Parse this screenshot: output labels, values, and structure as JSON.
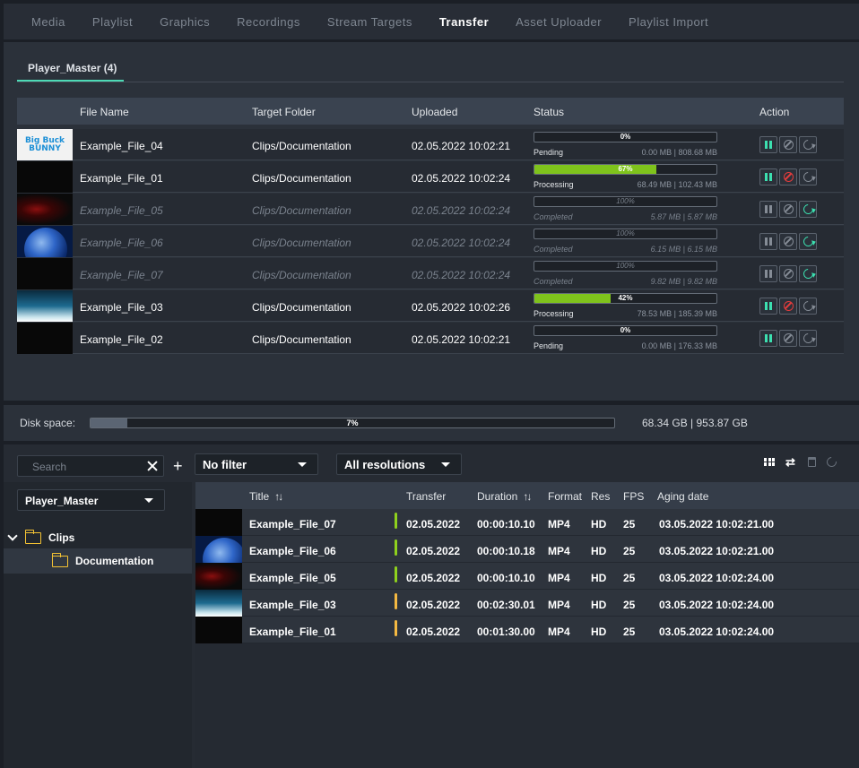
{
  "nav": {
    "tabs": [
      {
        "label": "Media"
      },
      {
        "label": "Playlist"
      },
      {
        "label": "Graphics"
      },
      {
        "label": "Recordings"
      },
      {
        "label": "Stream Targets"
      },
      {
        "label": "Transfer",
        "active": true
      },
      {
        "label": "Asset Uploader"
      },
      {
        "label": "Playlist Import"
      }
    ]
  },
  "transfer": {
    "subtab": "Player_Master (4)",
    "headers": {
      "file_name": "File Name",
      "target_folder": "Target Folder",
      "uploaded": "Uploaded",
      "status": "Status",
      "action": "Action"
    },
    "rows": [
      {
        "file_name": "Example_File_04",
        "target_folder": "Clips/Documentation",
        "uploaded": "02.05.2022 10:02:21",
        "progress": 0,
        "pct": "0%",
        "status": "Pending",
        "size": "0.00 MB | 808.68 MB",
        "thumb": "bunny",
        "pause": "on",
        "cancel": "grey",
        "retry": "grey",
        "done": false
      },
      {
        "file_name": "Example_File_01",
        "target_folder": "Clips/Documentation",
        "uploaded": "02.05.2022 10:02:24",
        "progress": 67,
        "pct": "67%",
        "status": "Processing",
        "size": "68.49 MB | 102.43 MB",
        "thumb": "black",
        "pause": "on",
        "cancel": "red",
        "retry": "grey",
        "done": false
      },
      {
        "file_name": "Example_File_05",
        "target_folder": "Clips/Documentation",
        "uploaded": "02.05.2022 10:02:24",
        "progress": 0,
        "pct": "100%",
        "status": "Completed",
        "size": "5.87 MB | 5.87 MB",
        "thumb": "red",
        "pause": "off",
        "cancel": "grey",
        "retry": "on",
        "done": true
      },
      {
        "file_name": "Example_File_06",
        "target_folder": "Clips/Documentation",
        "uploaded": "02.05.2022 10:02:24",
        "progress": 0,
        "pct": "100%",
        "status": "Completed",
        "size": "6.15 MB | 6.15 MB",
        "thumb": "earth",
        "pause": "off",
        "cancel": "grey",
        "retry": "on",
        "done": true
      },
      {
        "file_name": "Example_File_07",
        "target_folder": "Clips/Documentation",
        "uploaded": "02.05.2022 10:02:24",
        "progress": 0,
        "pct": "100%",
        "status": "Completed",
        "size": "9.82 MB | 9.82 MB",
        "thumb": "black",
        "pause": "off",
        "cancel": "grey",
        "retry": "on",
        "done": true
      },
      {
        "file_name": "Example_File_03",
        "target_folder": "Clips/Documentation",
        "uploaded": "02.05.2022 10:02:26",
        "progress": 42,
        "pct": "42%",
        "status": "Processing",
        "size": "78.53 MB | 185.39 MB",
        "thumb": "sky",
        "pause": "on",
        "cancel": "red",
        "retry": "grey",
        "done": false
      },
      {
        "file_name": "Example_File_02",
        "target_folder": "Clips/Documentation",
        "uploaded": "02.05.2022 10:02:21",
        "progress": 0,
        "pct": "0%",
        "status": "Pending",
        "size": "0.00 MB | 176.33 MB",
        "thumb": "black",
        "pause": "on",
        "cancel": "grey",
        "retry": "grey",
        "done": false
      }
    ]
  },
  "disk": {
    "label": "Disk space:",
    "progress": 7,
    "pct": "7%",
    "size": "68.34 GB | 953.87 GB"
  },
  "asset": {
    "search_placeholder": "Search",
    "filter": "No filter",
    "resolution": "All resolutions",
    "player": "Player_Master",
    "tree": {
      "root": "Clips",
      "child": "Documentation"
    },
    "headers": {
      "title": "Title",
      "transfer": "Transfer",
      "duration": "Duration",
      "format": "Format",
      "res": "Res",
      "fps": "FPS",
      "aging": "Aging date"
    },
    "rows": [
      {
        "title": "Example_File_07",
        "transfer": "02.05.2022",
        "duration": "00:00:10.10",
        "format": "MP4",
        "res": "HD",
        "fps": "25",
        "aging": "03.05.2022 10:02:21.00",
        "flag": "#8fd11d",
        "thumb": "black"
      },
      {
        "title": "Example_File_06",
        "transfer": "02.05.2022",
        "duration": "00:00:10.18",
        "format": "MP4",
        "res": "HD",
        "fps": "25",
        "aging": "03.05.2022 10:02:21.00",
        "flag": "#8fd11d",
        "thumb": "earth"
      },
      {
        "title": "Example_File_05",
        "transfer": "02.05.2022",
        "duration": "00:00:10.10",
        "format": "MP4",
        "res": "HD",
        "fps": "25",
        "aging": "03.05.2022 10:02:24.00",
        "flag": "#8fd11d",
        "thumb": "red"
      },
      {
        "title": "Example_File_03",
        "transfer": "02.05.2022",
        "duration": "00:02:30.01",
        "format": "MP4",
        "res": "HD",
        "fps": "25",
        "aging": "03.05.2022 10:02:24.00",
        "flag": "#f5b942",
        "thumb": "sky"
      },
      {
        "title": "Example_File_01",
        "transfer": "02.05.2022",
        "duration": "00:01:30.00",
        "format": "MP4",
        "res": "HD",
        "fps": "25",
        "aging": "03.05.2022 10:02:24.00",
        "flag": "#f5b942",
        "thumb": "black"
      }
    ]
  },
  "colors": {
    "accent": "#3ce0b0",
    "progress": "#7fc31c",
    "cancel_active": "#e33c3c",
    "folder": "#f3c233"
  }
}
